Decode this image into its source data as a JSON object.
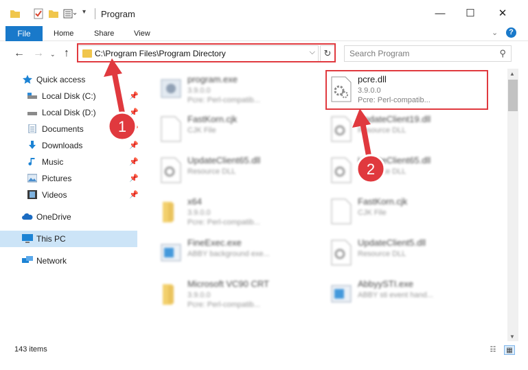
{
  "window": {
    "title": "Program",
    "minimize_glyph": "—",
    "maximize_glyph": "☐",
    "close_glyph": "✕"
  },
  "ribbon": {
    "tabs": [
      "File",
      "Home",
      "Share",
      "View"
    ],
    "help_glyph": "?"
  },
  "nav": {
    "address": "C:\\Program Files\\Program Directory",
    "search_placeholder": "Search Program"
  },
  "sidebar": {
    "items": [
      {
        "label": "Quick access",
        "icon": "star-icon",
        "pinned": false
      },
      {
        "label": "Local Disk (C:)",
        "icon": "drive-icon",
        "pinned": true
      },
      {
        "label": "Local Disk (D:)",
        "icon": "drive-icon",
        "pinned": true
      },
      {
        "label": "Documents",
        "icon": "documents-icon",
        "pinned": true
      },
      {
        "label": "Downloads",
        "icon": "download-icon",
        "pinned": true
      },
      {
        "label": "Music",
        "icon": "music-icon",
        "pinned": true
      },
      {
        "label": "Pictures",
        "icon": "pictures-icon",
        "pinned": true
      },
      {
        "label": "Videos",
        "icon": "videos-icon",
        "pinned": true
      },
      {
        "label": "OneDrive",
        "icon": "cloud-icon",
        "pinned": false
      },
      {
        "label": "This PC",
        "icon": "pc-icon",
        "pinned": false
      },
      {
        "label": "Network",
        "icon": "network-icon",
        "pinned": false
      }
    ]
  },
  "files": [
    {
      "name": "program.exe",
      "sub1": "3.9.0.0",
      "sub2": "Pcre: Perl-compatib...",
      "icon": "exe-icon"
    },
    {
      "name": "pcre.dll",
      "sub1": "3.9.0.0",
      "sub2": "Pcre: Perl-compatib...",
      "icon": "dll-icon"
    },
    {
      "name": "FastKorn.cjk",
      "sub1": "CJK File",
      "sub2": "",
      "icon": "file-icon"
    },
    {
      "name": "UpdateClient19.dll",
      "sub1": "Resource DLL",
      "sub2": "",
      "icon": "dll-icon"
    },
    {
      "name": "UpdateClient65.dll",
      "sub1": "Resource DLL",
      "sub2": "",
      "icon": "dll-icon"
    },
    {
      "name": "UpdateClient65.dll",
      "sub1": "Resource DLL",
      "sub2": "",
      "icon": "dll-icon"
    },
    {
      "name": "x64",
      "sub1": "3.9.0.0",
      "sub2": "Pcre: Perl-compatib...",
      "icon": "folder-icon"
    },
    {
      "name": "FastKorn.cjk",
      "sub1": "CJK File",
      "sub2": "",
      "icon": "file-icon"
    },
    {
      "name": "FineExec.exe",
      "sub1": "ABBY background exe...",
      "sub2": "",
      "icon": "exe-icon"
    },
    {
      "name": "UpdateClient5.dll",
      "sub1": "Resource DLL",
      "sub2": "",
      "icon": "dll-icon"
    },
    {
      "name": "Microsoft VC90 CRT",
      "sub1": "3.9.0.0",
      "sub2": "Pcre: Perl-compatib...",
      "icon": "folder-icon"
    },
    {
      "name": "AbbyySTI.exe",
      "sub1": "ABBY sti event hand...",
      "sub2": "",
      "icon": "exe-icon"
    }
  ],
  "annotations": {
    "badge_1": "1",
    "badge_2": "2"
  },
  "status": {
    "item_count": "143 items"
  },
  "colors": {
    "accent": "#1979ca",
    "highlight": "#e0393e",
    "selected": "#cce4f7"
  }
}
